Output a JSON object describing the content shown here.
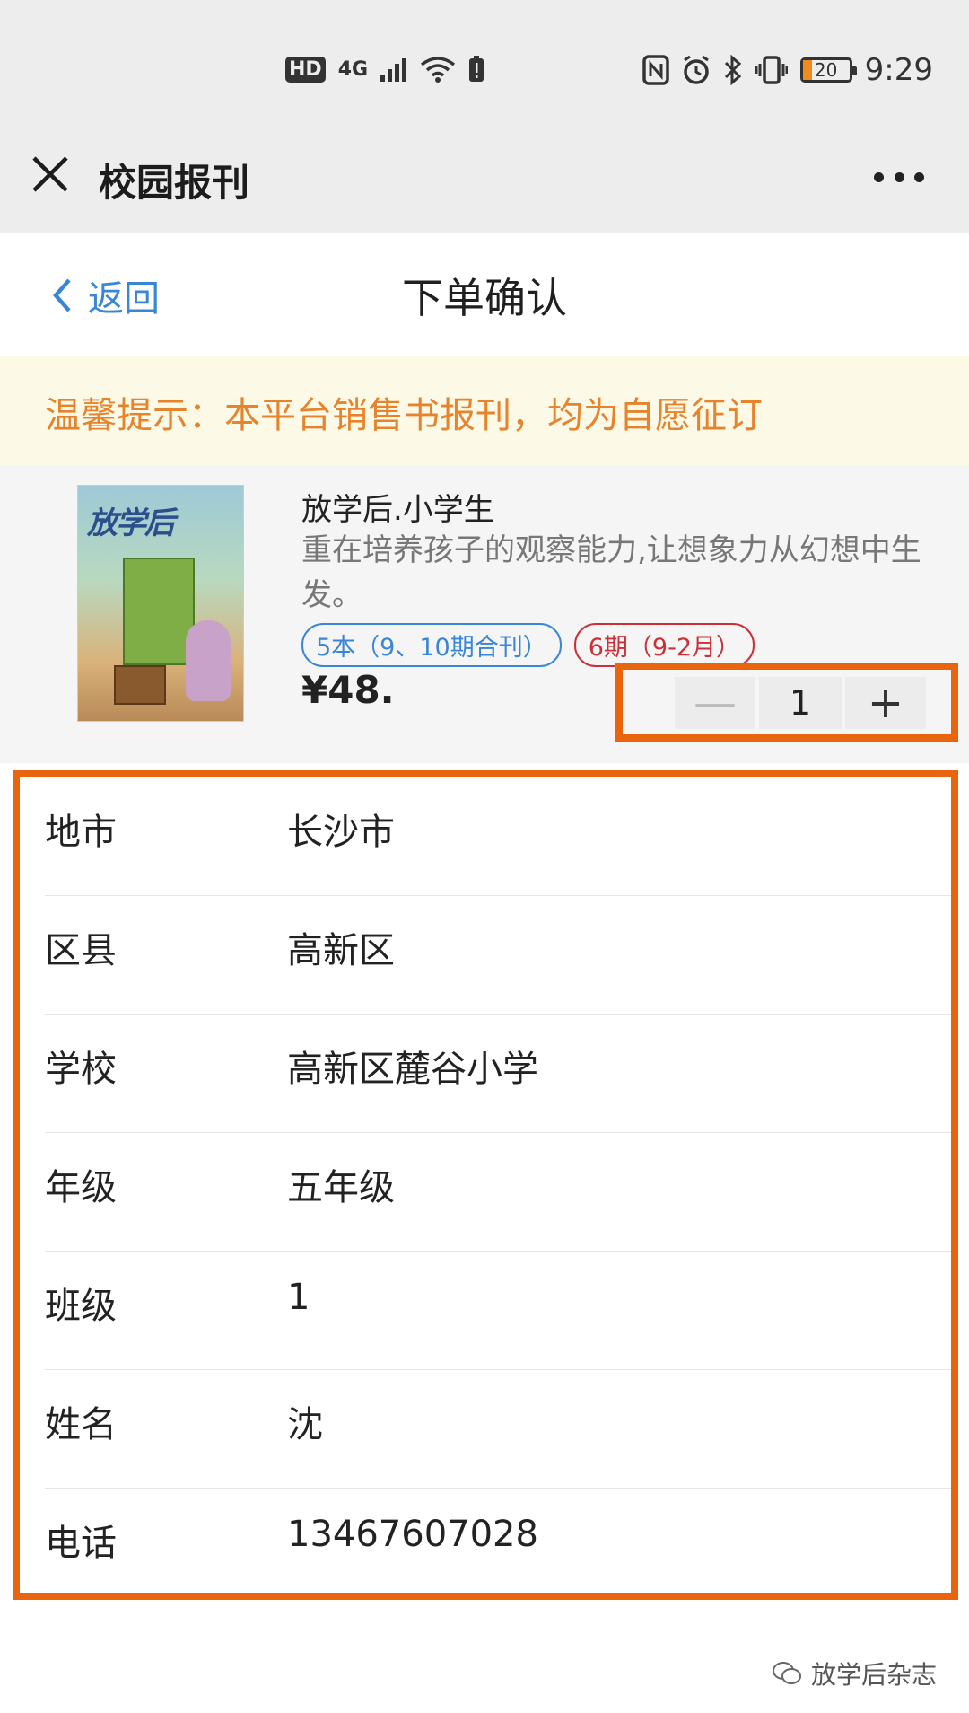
{
  "status_bar": {
    "hd": "HD",
    "network": "4G",
    "battery_level": "20",
    "time": "9:29"
  },
  "app_bar": {
    "title": "校园报刊"
  },
  "page_header": {
    "back_label": "返回",
    "title": "下单确认"
  },
  "notice": {
    "text": "温馨提示：本平台销售书报刊，均为自愿征订"
  },
  "product": {
    "cover_title": "放学后",
    "name": "放学后.小学生",
    "description": "重在培养孩子的观察能力,让想象力从幻想中生发。",
    "tags": [
      {
        "label": "5本（9、10期合刊）"
      },
      {
        "label": "6期（9-2月）"
      }
    ],
    "price": "¥48.",
    "quantity": "1",
    "minus_symbol": "—",
    "plus_symbol": "+"
  },
  "form": {
    "rows": [
      {
        "label": "地市",
        "value": "长沙市"
      },
      {
        "label": "区县",
        "value": "高新区"
      },
      {
        "label": "学校",
        "value": "高新区麓谷小学"
      },
      {
        "label": "年级",
        "value": "五年级"
      },
      {
        "label": "班级",
        "value": "1"
      },
      {
        "label": "姓名",
        "value": "沈"
      },
      {
        "label": "电话",
        "value": "13467607028"
      }
    ]
  },
  "watermark": {
    "text": "放学后杂志"
  },
  "colors": {
    "accent_blue": "#3a86d6",
    "highlight_orange": "#e8650e",
    "notice_text": "#e6842e",
    "tag_red": "#c9303a"
  }
}
